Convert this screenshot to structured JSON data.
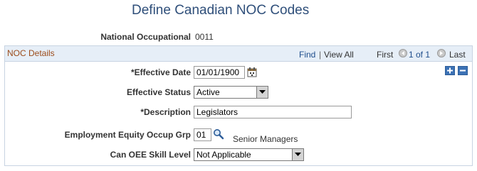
{
  "page": {
    "title": "Define Canadian NOC Codes"
  },
  "header": {
    "noc_label": "National Occupational",
    "noc_value": "0011"
  },
  "group": {
    "title": "NOC Details",
    "find": "Find",
    "separator": "|",
    "view_all": "View All",
    "first": "First",
    "range": "1 of 1",
    "last": "Last"
  },
  "form": {
    "effective_date_label": "*Effective Date",
    "effective_date_value": "01/01/1900",
    "effective_status_label": "Effective Status",
    "effective_status_value": "Active",
    "description_label": "*Description",
    "description_value": "Legislators",
    "equity_label": "Employment Equity Occup Grp",
    "equity_value": "01",
    "equity_description": "Senior Managers",
    "oee_label": "Can OEE Skill Level",
    "oee_value": "Not Applicable"
  },
  "icons": {
    "calendar": "calendar-icon",
    "lookup": "magnifier-icon",
    "add": "plus-icon",
    "delete": "minus-icon",
    "prev": "previous-arrow-icon",
    "next": "next-arrow-icon"
  },
  "colors": {
    "title": "#2f4f7a",
    "group_header_bg": "#e6eef7",
    "group_title": "#9c4c1b",
    "link": "#1f4e8c",
    "button_blue": "#3c72b5"
  }
}
